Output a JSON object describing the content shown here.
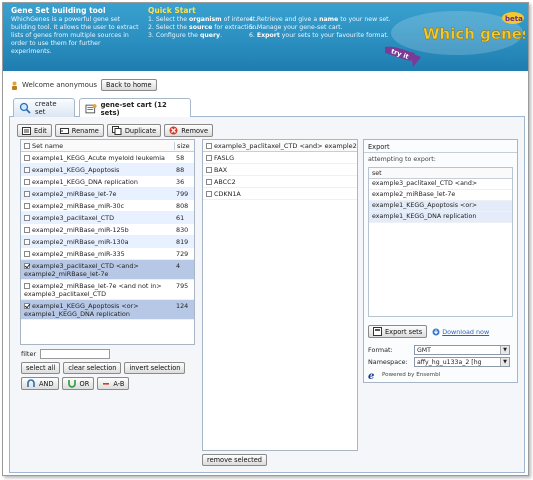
{
  "banner": {
    "app_title": "Gene Set building tool",
    "description": "WhichGenes is a powerful gene set building tool. It allows the user to extract lists of genes from multiple sources in order to use them for further experiments.",
    "quick_start_title": "Quick Start",
    "steps_col1": [
      {
        "pre": "1. Select the ",
        "bold": "organism",
        "post": " of interest."
      },
      {
        "pre": "2. Select the ",
        "bold": "source",
        "post": " for extraction."
      },
      {
        "pre": "3. Configure the ",
        "bold": "query",
        "post": "."
      }
    ],
    "steps_col2": [
      {
        "pre": "4. Retrieve and give a ",
        "bold": "name",
        "post": " to your new set."
      },
      {
        "pre": "5. Manage your gene-set cart.",
        "bold": "",
        "post": ""
      },
      {
        "pre": "6. ",
        "bold": "Export",
        "post": " your sets to your favourite format."
      }
    ],
    "logo_text": "Which genes?",
    "logo_beta": "beta",
    "logo_try": "try it"
  },
  "user": {
    "welcome": "Welcome anonymous",
    "back_home": "Back to home"
  },
  "tabs": [
    {
      "label": "create set"
    },
    {
      "label": "gene-set cart (12 sets)"
    }
  ],
  "toolbar": {
    "edit": "Edit",
    "rename": "Rename",
    "duplicate": "Duplicate",
    "remove": "Remove"
  },
  "sets_table": {
    "col_name": "Set name",
    "col_size": "size",
    "rows": [
      {
        "name": "example1_KEGG_Acute myeloid leukemia",
        "size": "58",
        "checked": false
      },
      {
        "name": "example1_KEGG_Apoptosis",
        "size": "88",
        "checked": false
      },
      {
        "name": "example1_KEGG_DNA replication",
        "size": "36",
        "checked": false
      },
      {
        "name": "example2_miRBase_let-7e",
        "size": "799",
        "checked": false
      },
      {
        "name": "example2_miRBase_miR-30c",
        "size": "808",
        "checked": false
      },
      {
        "name": "example3_paclitaxel_CTD",
        "size": "61",
        "checked": false
      },
      {
        "name": "example2_miRBase_miR-125b",
        "size": "830",
        "checked": false
      },
      {
        "name": "example2_miRBase_miR-130a",
        "size": "819",
        "checked": false
      },
      {
        "name": "example2_miRBase_miR-335",
        "size": "729",
        "checked": false
      },
      {
        "name": "example3_paclitaxel_CTD <and> example2_miRBase_let-7e",
        "size": "4",
        "checked": true
      },
      {
        "name": "example2_miRBase_let-7e <and not in> example3_paclitaxel_CTD",
        "size": "795",
        "checked": false
      },
      {
        "name": "example1_KEGG_Apoptosis <or> example1_KEGG_DNA replication",
        "size": "124",
        "checked": true
      }
    ]
  },
  "filter": {
    "label": "filter",
    "value": ""
  },
  "selection_buttons": {
    "select_all": "select all",
    "clear_selection": "clear selection",
    "invert_selection": "invert selection"
  },
  "operations": {
    "and": "AND",
    "or": "OR",
    "a_minus_b": "A-B"
  },
  "genes_table": {
    "header": "example3_paclitaxel_CTD <and> example2",
    "genes": [
      "FASLG",
      "BAX",
      "ABCC2",
      "CDKN1A"
    ],
    "remove_selected": "remove selected"
  },
  "export": {
    "title": "Export",
    "attempting": "attempting to export:",
    "set_header": "set",
    "sets": [
      "example3_paclitaxel_CTD <and>",
      "example2_miRBase_let-7e",
      "example1_KEGG_Apoptosis <or>",
      "example1_KEGG_DNA replication"
    ],
    "export_button": "Export sets",
    "download_link": "Download now",
    "format_label": "Format:",
    "format_value": "GMT",
    "namespace_label": "Namespace:",
    "namespace_value": "affy_hg_u133a_2 [hg",
    "powered_by": "Powered by Ensembl"
  },
  "colors": {
    "banner": "#2b8fc0",
    "accent_yellow": "#ffe14a",
    "selected_row": "#b7c8e6",
    "logo_purple": "#7b3a96"
  }
}
